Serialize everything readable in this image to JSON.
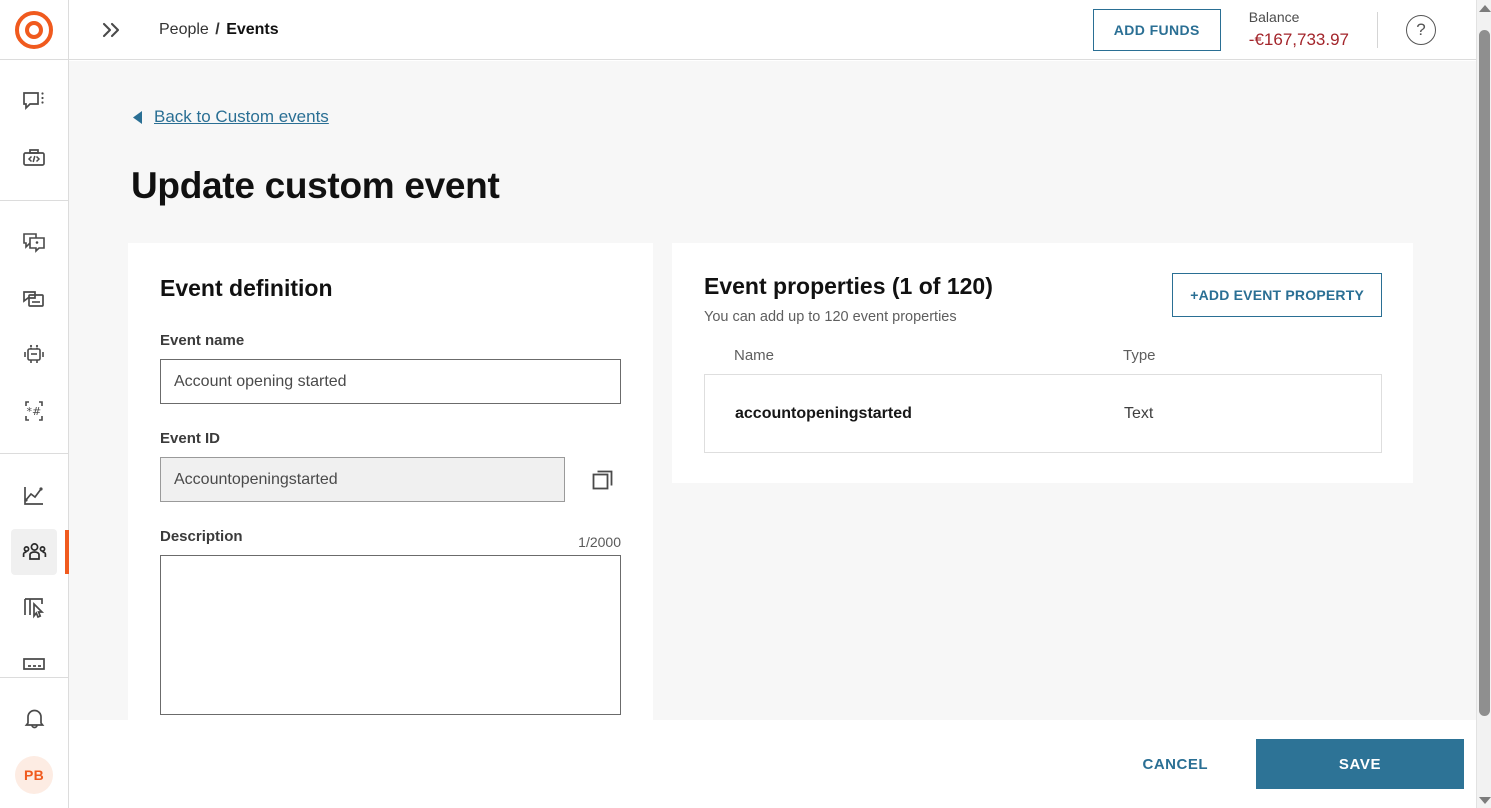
{
  "brand": {
    "logo_name": "target-logo",
    "accent_orange": "#f05a1e",
    "accent_blue": "#2a6f94",
    "balance_red": "#a3252b"
  },
  "topbar": {
    "expand_icon": "chevron-double-right-icon",
    "breadcrumb": {
      "parent": "People",
      "separator": "/",
      "current": "Events"
    },
    "add_funds_label": "ADD FUNDS",
    "balance_label": "Balance",
    "balance_value": "-€167,733.97",
    "help_glyph": "?"
  },
  "rail": {
    "items": [
      {
        "name": "sidebar-item-messages",
        "icon": "chat-bubble-dots-icon",
        "selected": false
      },
      {
        "name": "sidebar-item-developers",
        "icon": "toolbox-code-icon",
        "selected": false
      },
      {
        "name": "sidebar-item-campaigns",
        "icon": "multi-chat-star-icon",
        "selected": false
      },
      {
        "name": "sidebar-item-templates",
        "icon": "chat-document-icon",
        "selected": false
      },
      {
        "name": "sidebar-item-bots",
        "icon": "robot-icon",
        "selected": false
      },
      {
        "name": "sidebar-item-numbers",
        "icon": "asterisk-hash-keypad-icon",
        "selected": false
      },
      {
        "name": "sidebar-item-analytics",
        "icon": "line-chart-icon",
        "selected": false
      },
      {
        "name": "sidebar-item-people",
        "icon": "people-group-icon",
        "selected": true
      },
      {
        "name": "sidebar-item-journeys",
        "icon": "flow-cursor-icon",
        "selected": false
      },
      {
        "name": "sidebar-item-more",
        "icon": "panel-dots-icon",
        "selected": false
      }
    ],
    "notifications_icon": "bell-icon",
    "avatar_initials": "PB"
  },
  "page": {
    "back_link": "Back to Custom events",
    "back_caret_icon": "caret-left-icon",
    "title": "Update custom event"
  },
  "event_definition": {
    "card_title": "Event definition",
    "name_label": "Event name",
    "name_value": "Account opening started",
    "name_placeholder": "Account opening started",
    "id_label": "Event ID",
    "id_value": "Accountopeningstarted",
    "copy_icon": "copy-icon",
    "description_label": "Description",
    "description_counter": "1/2000",
    "description_value": "",
    "description_placeholder": ""
  },
  "event_properties": {
    "title": "Event properties (1 of 120)",
    "subtitle": "You can add up to 120 event properties",
    "add_button_label": "+ADD EVENT PROPERTY",
    "columns": [
      "Name",
      "Type"
    ],
    "rows": [
      {
        "name": "accountopeningstarted",
        "type": "Text"
      }
    ]
  },
  "footer": {
    "cancel_label": "CANCEL",
    "save_label": "SAVE"
  },
  "scrollbar": {
    "up_icon": "scroll-up-arrow-icon",
    "down_icon": "scroll-down-arrow-icon"
  }
}
